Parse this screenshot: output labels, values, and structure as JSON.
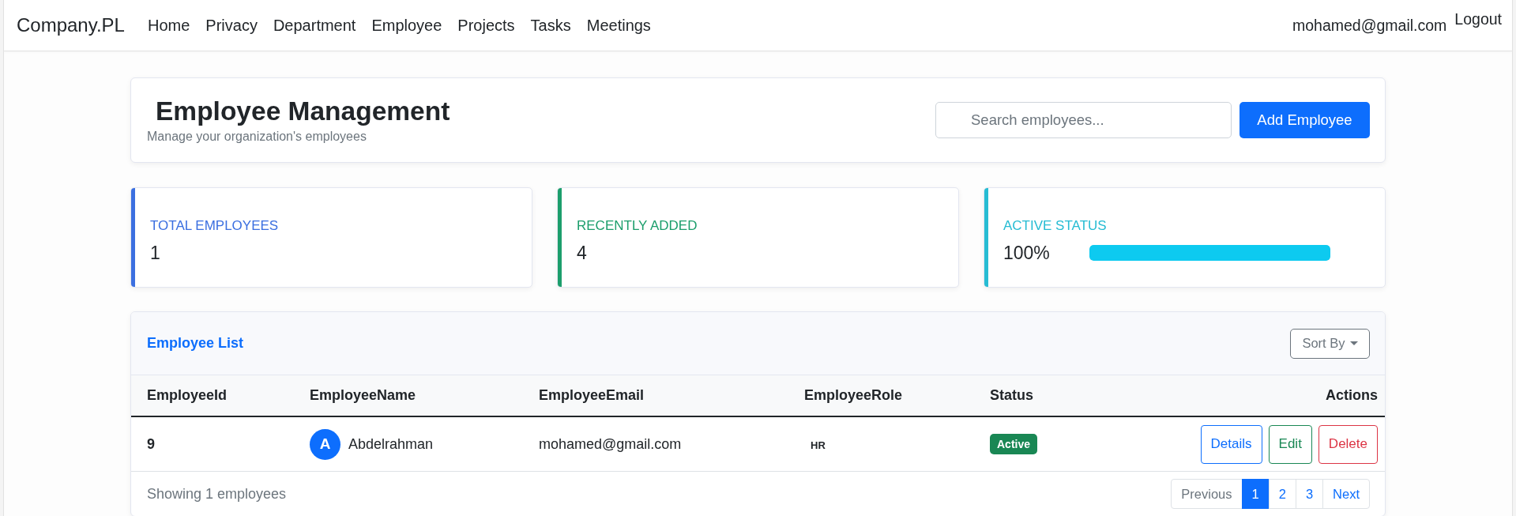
{
  "navbar": {
    "brand": "Company.PL",
    "links": [
      {
        "label": "Home"
      },
      {
        "label": "Privacy"
      },
      {
        "label": "Department"
      },
      {
        "label": "Employee"
      },
      {
        "label": "Projects"
      },
      {
        "label": "Tasks"
      },
      {
        "label": "Meetings"
      }
    ],
    "user_email": "mohamed@gmail.com",
    "logout": "Logout"
  },
  "header": {
    "title": "Employee Management",
    "subtitle": "Manage your organization's employees",
    "search": {
      "placeholder": "Search employees..."
    },
    "add_button": "Add Employee"
  },
  "stats": [
    {
      "kind": "count",
      "label": "TOTAL EMPLOYEES",
      "value": "1",
      "color": "#3b6fe0"
    },
    {
      "kind": "count",
      "label": "RECENTLY ADDED",
      "value": "4",
      "color": "#1c9e6c"
    },
    {
      "kind": "progress",
      "label": "ACTIVE STATUS",
      "value": "100%",
      "level": 1,
      "color": "#26bcd3"
    }
  ],
  "employee_list": {
    "title": "Employee List",
    "sort_button": "Sort By",
    "table": {
      "columns": [
        "EmployeeId",
        "EmployeeName",
        "EmployeeEmail",
        "EmployeeRole",
        "Status",
        "Actions"
      ],
      "rows": [
        {
          "id": "9",
          "avatar_initial": "A",
          "name": "Abdelrahman",
          "email": "mohamed@gmail.com",
          "role": "HR",
          "status": "Active",
          "actions": [
            {
              "kind": "primary",
              "label": "Details"
            },
            {
              "kind": "success",
              "label": "Edit"
            },
            {
              "kind": "danger",
              "label": "Delete"
            }
          ]
        }
      ]
    },
    "footer": {
      "summary": "Showing 1 employees",
      "pagination": {
        "previous": {
          "label": "Previous",
          "disabled": true
        },
        "pages": [
          {
            "label": "1",
            "selected": true
          },
          {
            "label": "2",
            "selected": false
          },
          {
            "label": "3",
            "selected": false
          }
        ],
        "next": {
          "label": "Next",
          "disabled": false
        }
      }
    }
  }
}
